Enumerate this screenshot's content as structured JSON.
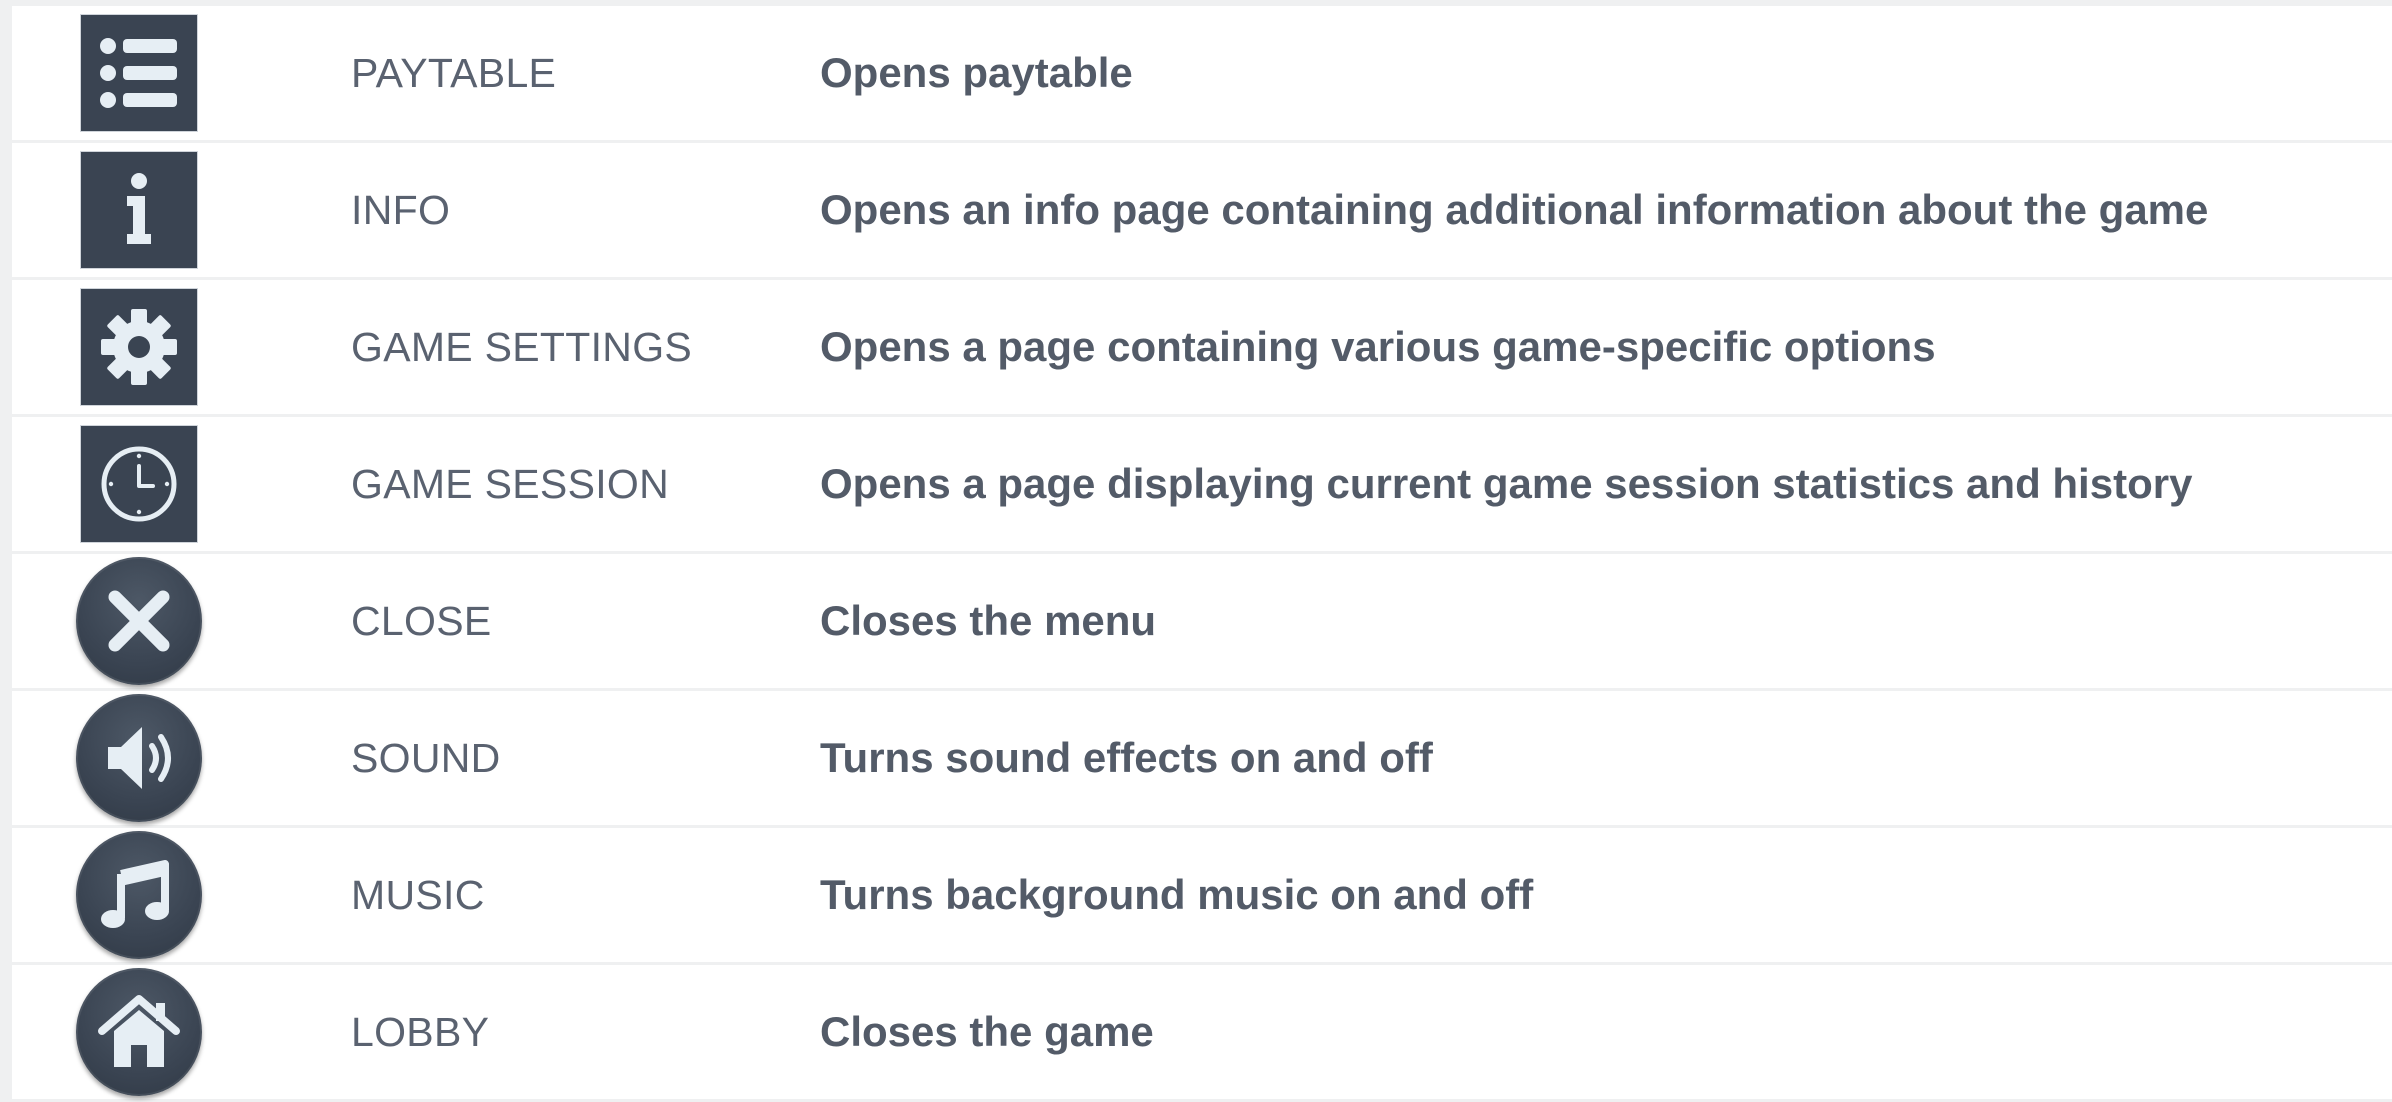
{
  "colors": {
    "icon_background": "#3a4452",
    "icon_glyph": "#e6eef4",
    "name_text": "#5a6270",
    "description_text": "#535b68",
    "row_background": "#ffffff",
    "separator": "#eff0f1"
  },
  "rows": [
    {
      "icon": "list-icon",
      "name": "PAYTABLE",
      "description": "Opens paytable"
    },
    {
      "icon": "info-icon",
      "name": "INFO",
      "description": "Opens an info page containing additional information about the game"
    },
    {
      "icon": "gear-icon",
      "name": "GAME SETTINGS",
      "description": "Opens a page containing various game-specific options"
    },
    {
      "icon": "clock-icon",
      "name": "GAME SESSION",
      "description": "Opens a page displaying current game session statistics and history"
    },
    {
      "icon": "close-icon",
      "name": "CLOSE",
      "description": "Closes the menu"
    },
    {
      "icon": "speaker-icon",
      "name": "SOUND",
      "description": "Turns sound effects on and off"
    },
    {
      "icon": "music-note-icon",
      "name": "MUSIC",
      "description": "Turns background music on and off"
    },
    {
      "icon": "home-icon",
      "name": "LOBBY",
      "description": "Closes the game"
    }
  ]
}
